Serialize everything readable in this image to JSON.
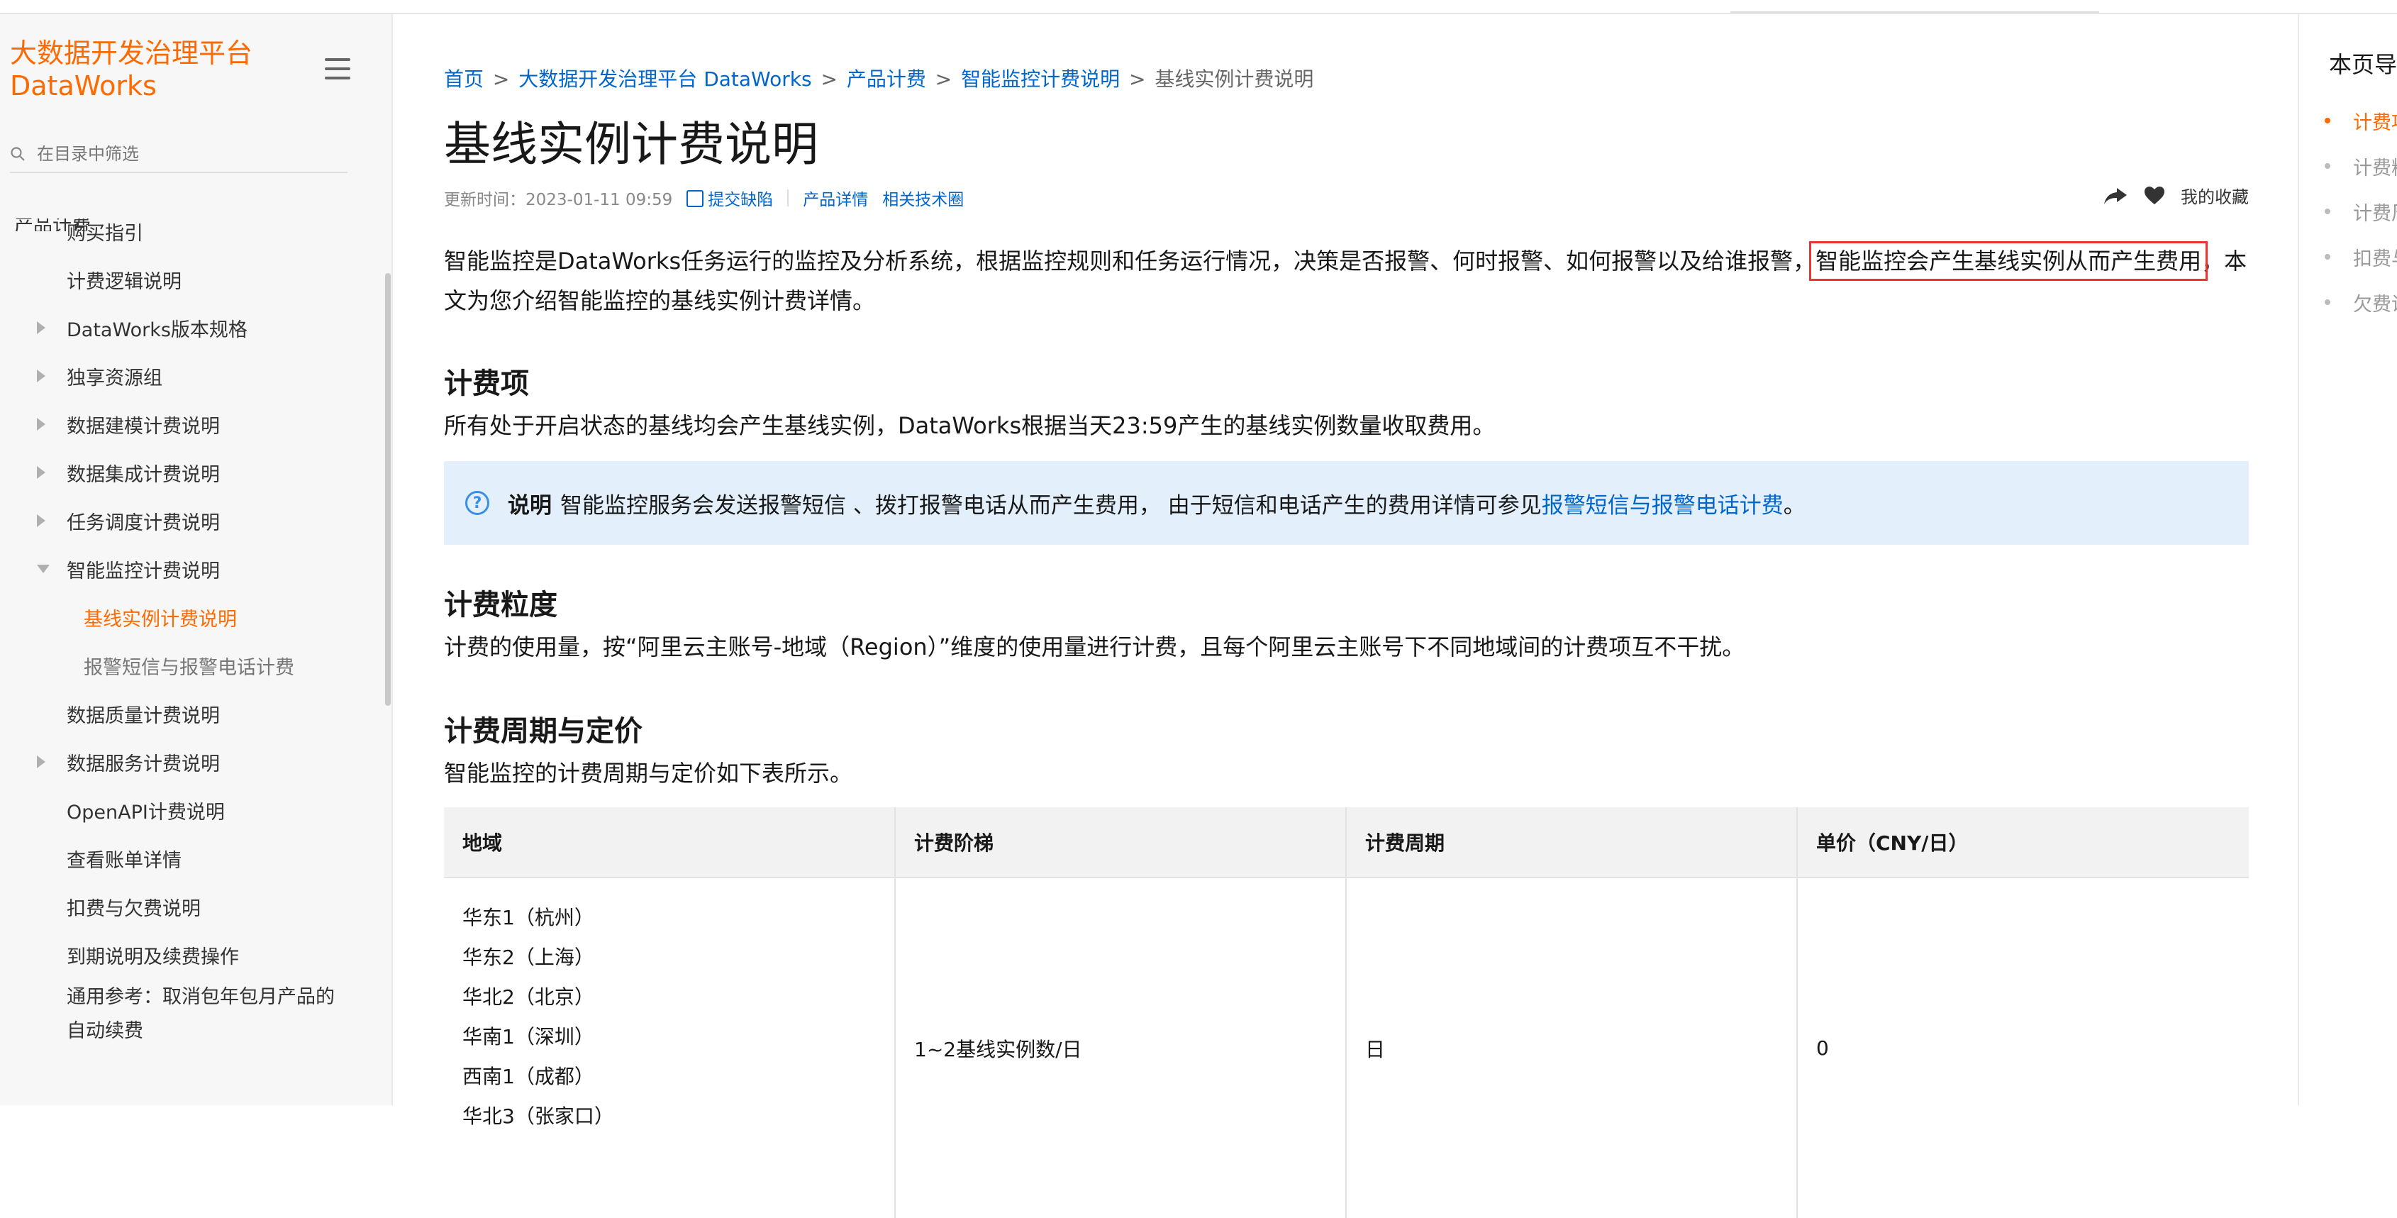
{
  "sidebar": {
    "brand_line1": "大数据开发治理平台",
    "brand_line2": "DataWorks",
    "filter_placeholder": "在目录中筛选",
    "partial_item": "产品计费",
    "items": [
      {
        "label": "购买指引"
      },
      {
        "label": "计费逻辑说明"
      },
      {
        "label": "DataWorks版本规格"
      },
      {
        "label": "独享资源组"
      },
      {
        "label": "数据建模计费说明"
      },
      {
        "label": "数据集成计费说明"
      },
      {
        "label": "任务调度计费说明"
      },
      {
        "label": "智能监控计费说明"
      },
      {
        "label": "基线实例计费说明"
      },
      {
        "label": "报警短信与报警电话计费"
      },
      {
        "label": "数据质量计费说明"
      },
      {
        "label": "数据服务计费说明"
      },
      {
        "label": "OpenAPI计费说明"
      },
      {
        "label": "查看账单详情"
      },
      {
        "label": "扣费与欠费说明"
      },
      {
        "label": "到期说明及续费操作"
      },
      {
        "label": "通用参考：取消包年包月产品的自动续费"
      }
    ]
  },
  "breadcrumb": {
    "home": "首页",
    "l2": "大数据开发治理平台 DataWorks",
    "l3": "产品计费",
    "l4": "智能监控计费说明",
    "current": "基线实例计费说明",
    "sep": ">"
  },
  "page": {
    "title": "基线实例计费说明",
    "updated": "更新时间：2023-01-11 09:59",
    "report_bug": "提交缺陷",
    "product_detail": "产品详情",
    "tech_circle": "相关技术圈",
    "favorites": "我的收藏"
  },
  "content": {
    "intro_a": "智能监控是DataWorks任务运行的监控及分析系统，根据监控规则和任务运行情况，决策是否报警、何时报警、如何报警以及给谁报警，",
    "intro_hl": "智能监控会产生基线实例从而产生费用",
    "intro_b": "，本文为您介绍智能监控的基线实例计费详情。",
    "sec1_title": "计费项",
    "sec1_text": "所有处于开启状态的基线均会产生基线实例，DataWorks根据当天23:59产生的基线实例数量收取费用。",
    "note_label": "说明",
    "note_text": "智能监控服务会发送报警短信 、拨打报警电话从而产生费用， 由于短信和电话产生的费用详情可参见",
    "note_link": "报警短信与报警电话计费",
    "note_end": "。",
    "sec2_title": "计费粒度",
    "sec2_text": "计费的使用量，按“阿里云主账号-地域（Region）”维度的使用量进行计费，且每个阿里云主账号下不同地域间的计费项互不干扰。",
    "sec3_title": "计费周期与定价",
    "sec3_text": "智能监控的计费周期与定价如下表所示。"
  },
  "table": {
    "headers": [
      "地域",
      "计费阶梯",
      "计费周期",
      "单价（CNY/日）"
    ],
    "regions": [
      "华东1（杭州）",
      "华东2（上海）",
      "华北2（北京）",
      "华南1（深圳）",
      "西南1（成都）",
      "华北3（张家口）"
    ],
    "tier": "1~2基线实例数/日",
    "cycle": "日",
    "price": "0"
  },
  "toc": {
    "title": "本页导读",
    "items": [
      "计费项",
      "计费粒度",
      "计费周期与定价",
      "扣费与欠费",
      "欠费说明"
    ]
  },
  "colors": {
    "brand": "#ff6a00",
    "link": "#0066cc",
    "note_bg": "#e3f0fb",
    "highlight_border": "#e33333"
  }
}
